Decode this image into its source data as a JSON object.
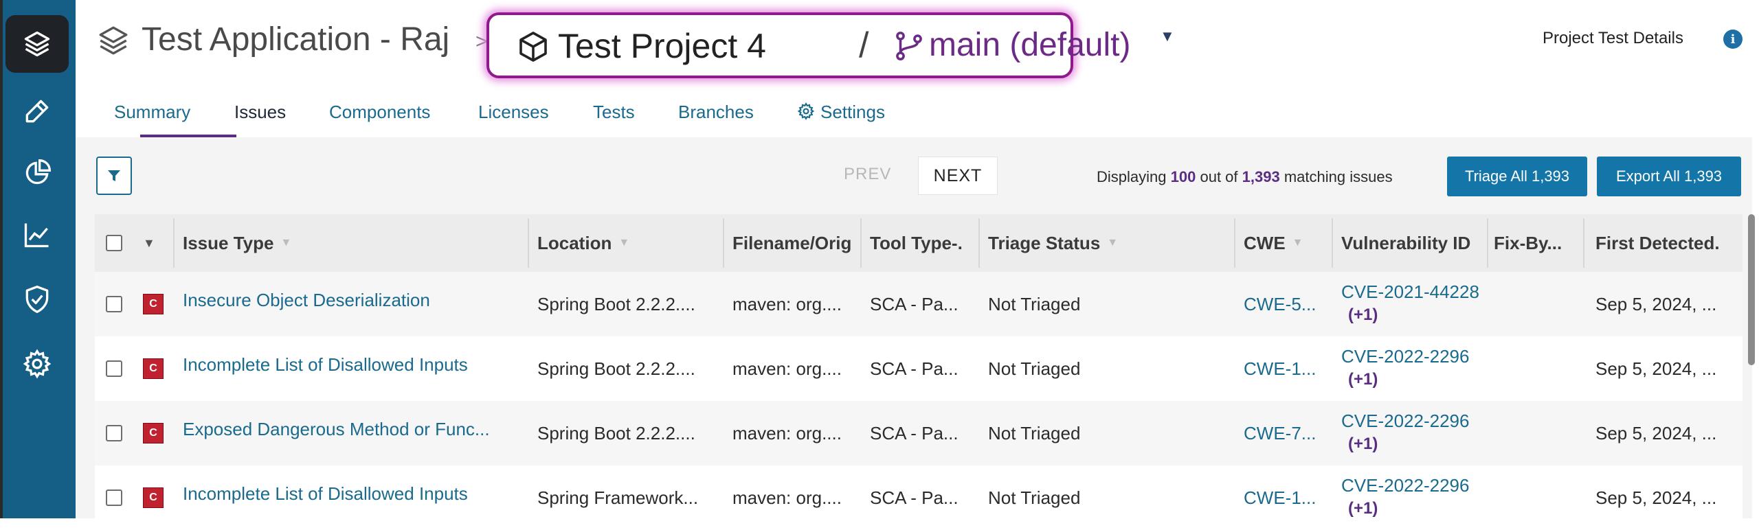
{
  "sidebar": {
    "icons": [
      "layers-icon",
      "pencil-icon",
      "pie-chart-icon",
      "trend-chart-icon",
      "shield-check-icon",
      "gear-icon"
    ]
  },
  "header": {
    "app_title": "Test Application - Raj",
    "breadcrumb_separator": ">",
    "project_title": "Test Project 4",
    "slash": "/",
    "branch": "main (default)",
    "details_link": "Project Test Details",
    "info_glyph": "i"
  },
  "tabs": [
    {
      "label": "Summary"
    },
    {
      "label": "Issues",
      "active": true
    },
    {
      "label": "Components"
    },
    {
      "label": "Licenses"
    },
    {
      "label": "Tests"
    },
    {
      "label": "Branches"
    },
    {
      "label": "Settings"
    }
  ],
  "toolbar": {
    "prev": "PREV",
    "next": "NEXT",
    "display_prefix": "Displaying",
    "display_count": "100",
    "display_mid": "out of",
    "display_total": "1,393",
    "display_suffix": "matching issues",
    "triage_all": "Triage All 1,393",
    "export_all": "Export All 1,393"
  },
  "table": {
    "columns": [
      "Issue Type",
      "Location",
      "Filename/Orig",
      "Tool Type",
      "Triage Status",
      "CWE",
      "Vulnerability ID",
      "Fix-By",
      "First Detected"
    ],
    "column_display": [
      "Issue Type",
      "Location",
      "Filename/Orig",
      "Tool Type-.",
      "Triage Status",
      "CWE",
      "Vulnerability ID",
      "Fix-By...",
      "First Detected."
    ],
    "rows": [
      {
        "severity": "C",
        "issue_type": "Insecure Object Deserialization",
        "location": "Spring Boot 2.2.2....",
        "filename": "maven: org....",
        "tool_type": "SCA - Pa...",
        "triage": "Not Triaged",
        "cwe": "CWE-5...",
        "vuln_id": "CVE-2021-44228",
        "vuln_more": "(+1)",
        "fix_by": "",
        "first_detected": "Sep 5, 2024, ..."
      },
      {
        "severity": "C",
        "issue_type": "Incomplete List of Disallowed Inputs",
        "location": "Spring Boot 2.2.2....",
        "filename": "maven: org....",
        "tool_type": "SCA - Pa...",
        "triage": "Not Triaged",
        "cwe": "CWE-1...",
        "vuln_id": "CVE-2022-2296",
        "vuln_more": "(+1)",
        "fix_by": "",
        "first_detected": "Sep 5, 2024, ..."
      },
      {
        "severity": "C",
        "issue_type": "Exposed Dangerous Method or Func...",
        "location": "Spring Boot 2.2.2....",
        "filename": "maven: org....",
        "tool_type": "SCA - Pa...",
        "triage": "Not Triaged",
        "cwe": "CWE-7...",
        "vuln_id": "CVE-2022-2296",
        "vuln_more": "(+1)",
        "fix_by": "",
        "first_detected": "Sep 5, 2024, ..."
      },
      {
        "severity": "C",
        "issue_type": "Incomplete List of Disallowed Inputs",
        "location": "Spring Framework...",
        "filename": "maven: org....",
        "tool_type": "SCA - Pa...",
        "triage": "Not Triaged",
        "cwe": "CWE-1...",
        "vuln_id": "CVE-2022-2296",
        "vuln_more": "(+1)",
        "fix_by": "",
        "first_detected": "Sep 5, 2024, ..."
      }
    ]
  },
  "colors": {
    "sidebar": "#155f86",
    "accent": "#1375a8",
    "link": "#1a6a8e",
    "purple": "#5a2d82",
    "severity_critical": "#c0222f",
    "highlight": "#8f1a8a"
  }
}
